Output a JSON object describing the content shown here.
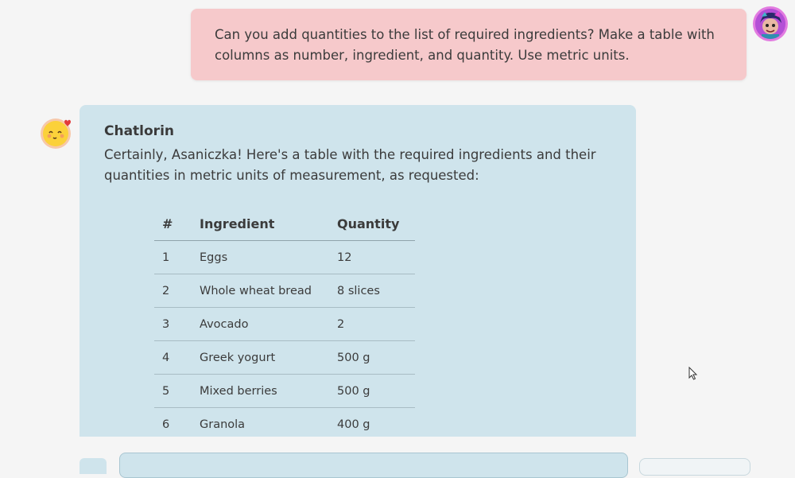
{
  "user_message": {
    "text": "Can you add quantities to the list of required ingredients? Make a table with columns as number, ingredient, and quantity. Use metric units."
  },
  "assistant_message": {
    "name": "Chatlorin",
    "text": "Certainly, Asaniczka! Here's a table with the required ingredients and their quantities in metric units of measurement, as requested:",
    "table": {
      "headers": [
        "#",
        "Ingredient",
        "Quantity"
      ],
      "rows": [
        [
          "1",
          "Eggs",
          "12"
        ],
        [
          "2",
          "Whole wheat bread",
          "8 slices"
        ],
        [
          "3",
          "Avocado",
          "2"
        ],
        [
          "4",
          "Greek yogurt",
          "500 g"
        ],
        [
          "5",
          "Mixed berries",
          "500 g"
        ],
        [
          "6",
          "Granola",
          "400 g"
        ]
      ]
    }
  },
  "colors": {
    "user_bubble": "#f6c9cb",
    "assistant_bubble": "#cfe4ec",
    "background": "#f5f5f5"
  }
}
